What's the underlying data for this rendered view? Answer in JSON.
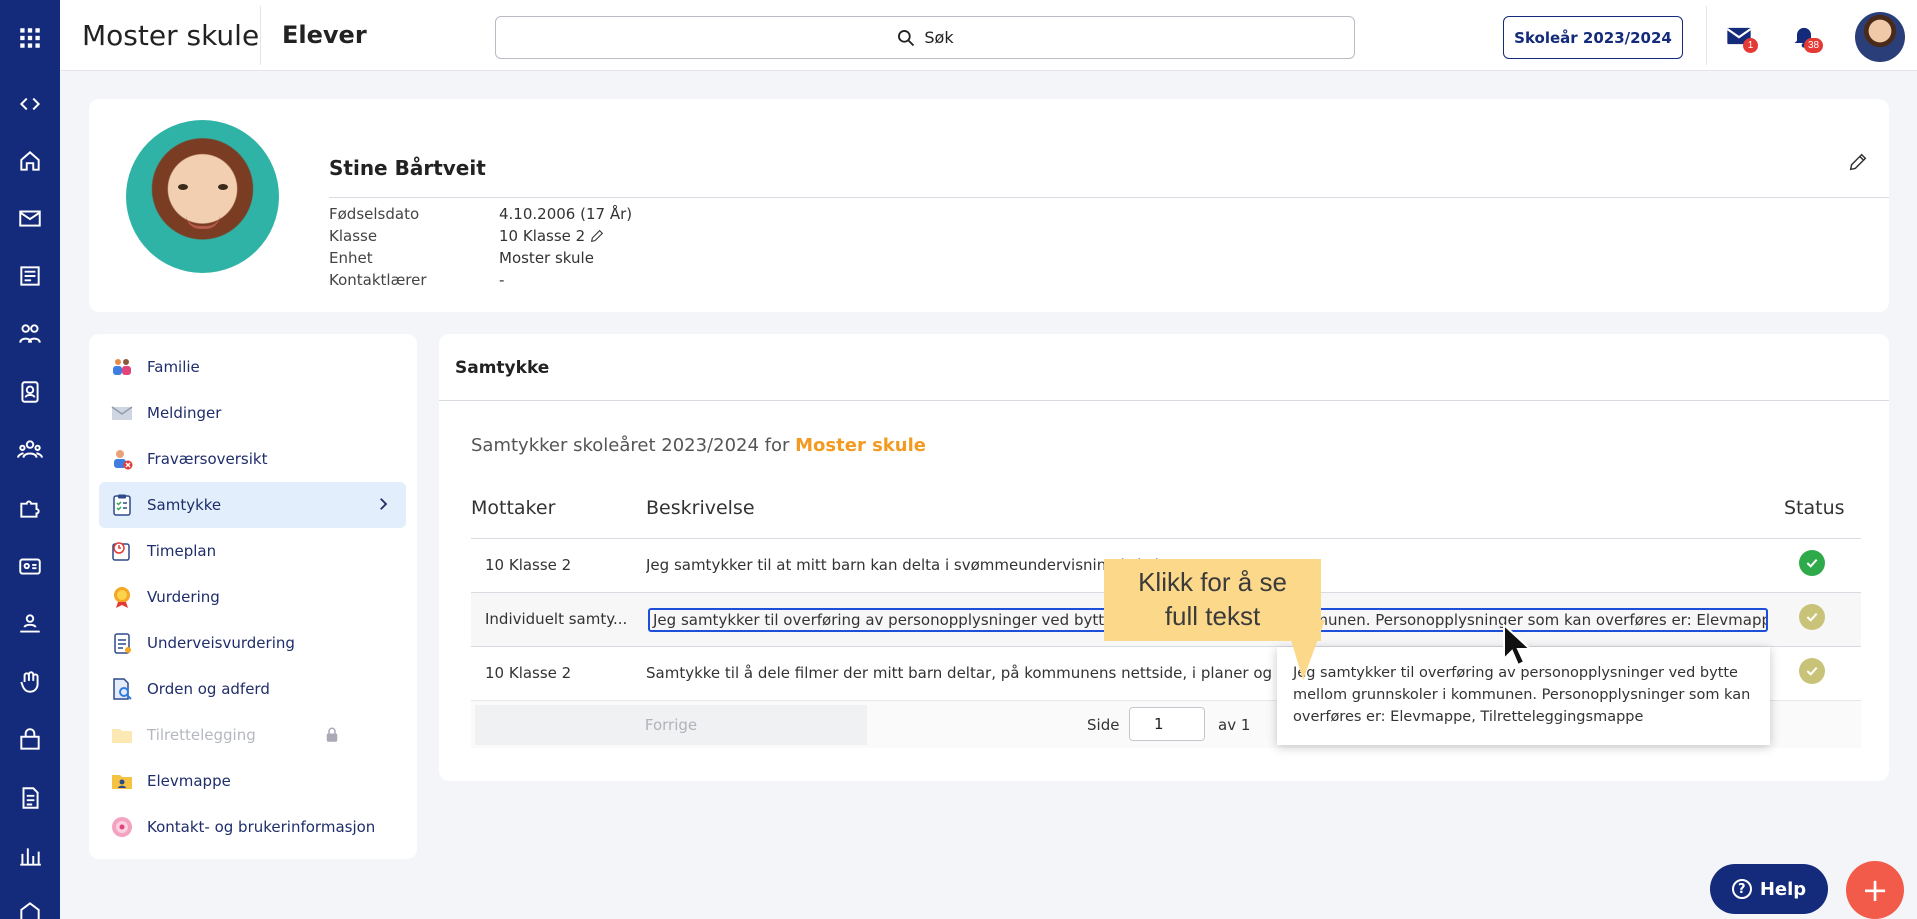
{
  "topbar": {
    "brand": "Moster skule",
    "section": "Elever",
    "search_label": "Søk",
    "school_year_button": "Skoleår 2023/2024",
    "mail_badge": "1",
    "notification_badge": "38"
  },
  "rail": {
    "icons": [
      "apps-grid-icon",
      "code-toggle-icon",
      "home-icon",
      "mail-icon",
      "news-icon",
      "groups-icon",
      "badge-icon",
      "people-icon",
      "puzzle-icon",
      "id-card-icon",
      "user-stand-icon",
      "hand-icon",
      "bag-icon",
      "document-icon",
      "bar-chart-icon",
      "building-icon"
    ]
  },
  "profile": {
    "name": "Stine Bårtveit",
    "fields": [
      {
        "label": "Fødselsdato",
        "value": "4.10.2006 (17 År)"
      },
      {
        "label": "Klasse",
        "value": "10 Klasse 2"
      },
      {
        "label": "Enhet",
        "value": "Moster skule"
      },
      {
        "label": "Kontaktlærer",
        "value": "-"
      }
    ]
  },
  "menu": {
    "items": [
      {
        "label": "Familie",
        "icon": "family-icon"
      },
      {
        "label": "Meldinger",
        "icon": "envelope-icon"
      },
      {
        "label": "Fraværsoversikt",
        "icon": "absence-icon"
      },
      {
        "label": "Samtykke",
        "icon": "clipboard-check-icon",
        "active": true
      },
      {
        "label": "Timeplan",
        "icon": "timetable-icon"
      },
      {
        "label": "Vurdering",
        "icon": "award-icon"
      },
      {
        "label": "Underveisvurdering",
        "icon": "clipboard-icon"
      },
      {
        "label": "Orden og adferd",
        "icon": "document-search-icon"
      },
      {
        "label": "Tilrettelegging",
        "icon": "folder-icon",
        "disabled": true
      },
      {
        "label": "Elevmappe",
        "icon": "student-folder-icon"
      },
      {
        "label": "Kontakt- og brukerinformasjon",
        "icon": "contact-info-icon"
      }
    ]
  },
  "consent": {
    "title": "Samtykke",
    "subtitle_prefix": "Samtykker skoleåret 2023/2024 for",
    "subtitle_school": "Moster skule",
    "columns": {
      "recipient": "Mottaker",
      "description": "Beskrivelse",
      "status": "Status"
    },
    "rows": [
      {
        "recipient": "10 Klasse 2",
        "description": "Jeg samtykker til at mitt barn kan delta i svømmeundervisning i skole",
        "status_color": "#2eaa4a"
      },
      {
        "recipient": "Individuelt samty...",
        "description": "Jeg samtykker til overføring av personopplysninger ved bytte mellom grunnskoler i kommunen. Personopplysninger som kan overføres er: Elevmappe, Tilretteleggings",
        "status_color": "#c9c37a"
      },
      {
        "recipient": "10 Klasse 2",
        "description": "Samtykke til å dele filmer der mitt barn deltar, på kommunens nettside, i planer og presentasjoner",
        "status_color": "#c9c37a"
      }
    ],
    "pager": {
      "previous": "Forrige",
      "page_label": "Side",
      "page_value": "1",
      "of_label": "av 1"
    }
  },
  "tooltip": {
    "text": "Jeg samtykker til overføring av personopplysninger ved bytte mellom grunnskoler i kommunen. Personopplysninger som kan overføres er: Elevmappe, Tilretteleggingsmappe"
  },
  "callout": {
    "line1": "Klikk for å se",
    "line2": "full tekst",
    "color": "#fcd88a"
  },
  "help": {
    "label": "Help"
  },
  "fab": {
    "label": "+"
  }
}
